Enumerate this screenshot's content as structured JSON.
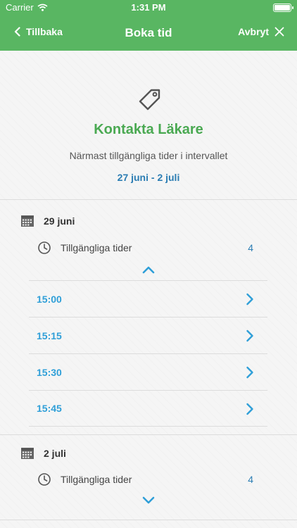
{
  "status_bar": {
    "carrier": "Carrier",
    "time": "1:31 PM"
  },
  "nav": {
    "back_label": "Tillbaka",
    "title": "Boka tid",
    "cancel_label": "Avbryt"
  },
  "hero": {
    "title": "Kontakta Läkare",
    "subtitle": "Närmast tillgängliga tider i intervallet",
    "range": "27 juni - 2 juli"
  },
  "days": [
    {
      "date": "29 juni",
      "available_label": "Tillgängliga tider",
      "available_count": "4",
      "expanded": true,
      "slots": [
        "15:00",
        "15:15",
        "15:30",
        "15:45"
      ]
    },
    {
      "date": "2 juli",
      "available_label": "Tillgängliga tider",
      "available_count": "4",
      "expanded": false,
      "slots": []
    }
  ],
  "colors": {
    "header": "#59b662",
    "title_green": "#4aa952",
    "link_blue": "#2f9fd8",
    "range_blue": "#2b7db3"
  }
}
